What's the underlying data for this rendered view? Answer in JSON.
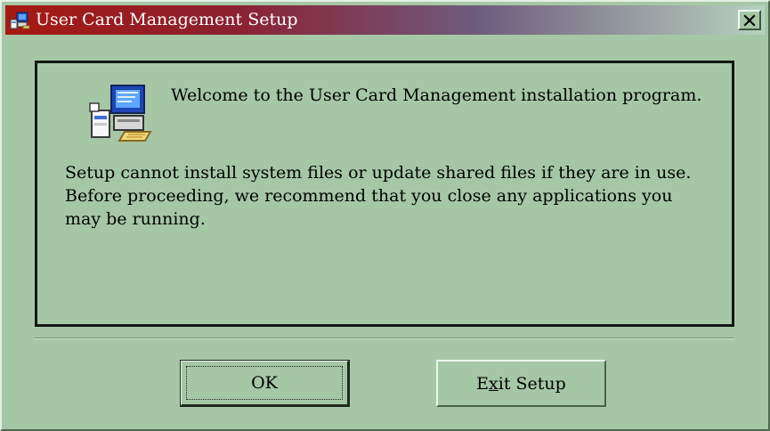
{
  "window": {
    "title": "User Card Management Setup",
    "title_icon": "setup-computer-icon",
    "close_label": "×",
    "colors": {
      "face": "#a6c7a6",
      "title_start": "#a51a12",
      "title_end": "#b7d2bf",
      "text": "#000000",
      "panel_border": "#111711"
    }
  },
  "content": {
    "icon": "setup-computer-icon",
    "welcome": "Welcome to the User Card Management installation program.",
    "message": "Setup cannot install system files or update shared files if they are in use.  Before proceeding, we recommend that you close any applications you may be running."
  },
  "buttons": {
    "ok": "OK",
    "exit_prefix": "E",
    "exit_mnemonic": "x",
    "exit_suffix": "it Setup"
  }
}
